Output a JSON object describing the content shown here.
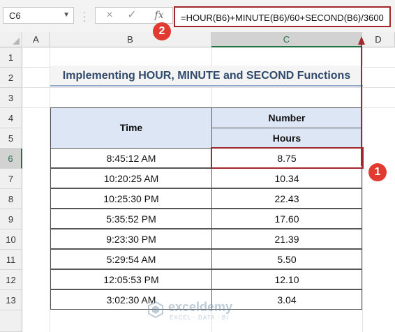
{
  "formula_bar": {
    "name_box": "C6",
    "formula": "=HOUR(B6)+MINUTE(B6)/60+SECOND(B6)/3600",
    "cancel_icon": "×",
    "enter_icon": "✓",
    "fx_label": "fx"
  },
  "columns": [
    "A",
    "B",
    "C",
    "D"
  ],
  "rows": [
    "1",
    "2",
    "3",
    "4",
    "5",
    "6",
    "7",
    "8",
    "9",
    "10",
    "11",
    "12",
    "13"
  ],
  "selected_cell": {
    "column": "C",
    "row": "6"
  },
  "title": "Implementing HOUR, MINUTE and SECOND Functions",
  "table": {
    "header_time": "Time",
    "header_number": "Number",
    "header_hours": "Hours",
    "rows": [
      {
        "time": "8:45:12 AM",
        "hours": "8.75"
      },
      {
        "time": "10:20:25 AM",
        "hours": "10.34"
      },
      {
        "time": "10:25:30 PM",
        "hours": "22.43"
      },
      {
        "time": "5:35:52 PM",
        "hours": "17.60"
      },
      {
        "time": "9:23:30 PM",
        "hours": "21.39"
      },
      {
        "time": "5:29:54 AM",
        "hours": "5.50"
      },
      {
        "time": "12:05:53 PM",
        "hours": "12.10"
      },
      {
        "time": "3:02:30 AM",
        "hours": "3.04"
      }
    ]
  },
  "annotations": {
    "badge_1": "1",
    "badge_2": "2"
  },
  "watermark": {
    "name": "exceldemy",
    "tagline": "EXCEL · DATA · BI"
  },
  "colors": {
    "accent_red": "#a0272b",
    "badge_red": "#e03a31",
    "header_fill": "#dce6f4",
    "excel_green": "#217346"
  }
}
